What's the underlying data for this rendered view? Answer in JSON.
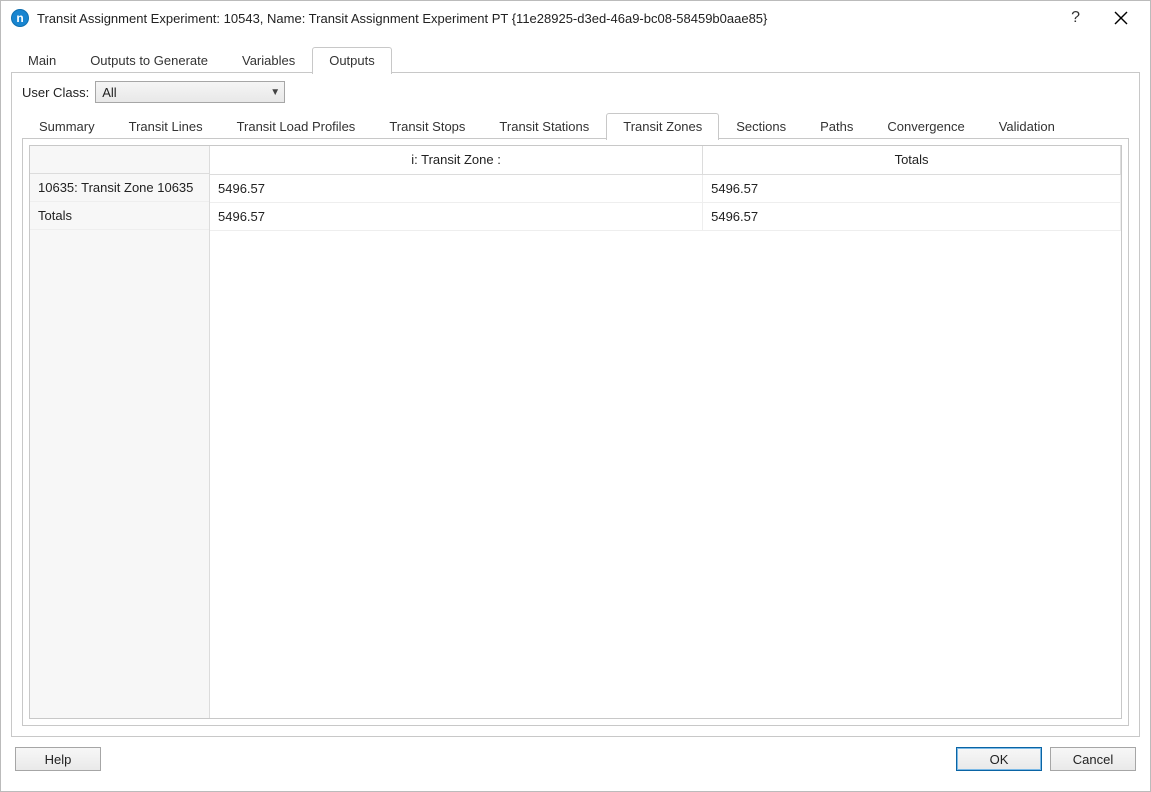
{
  "window": {
    "title": "Transit Assignment Experiment: 10543, Name: Transit Assignment Experiment PT  {11e28925-d3ed-46a9-bc08-58459b0aae85}",
    "icon_letter": "n",
    "help_glyph": "?",
    "close_glyph": "✕"
  },
  "top_tabs": {
    "main": "Main",
    "outputs_to_generate": "Outputs to Generate",
    "variables": "Variables",
    "outputs": "Outputs",
    "active": "outputs"
  },
  "user_class": {
    "label": "User Class:",
    "value": "All"
  },
  "sub_tabs": {
    "summary": "Summary",
    "transit_lines": "Transit Lines",
    "transit_load_profiles": "Transit Load Profiles",
    "transit_stops": "Transit Stops",
    "transit_stations": "Transit Stations",
    "transit_zones": "Transit Zones",
    "sections": "Sections",
    "paths": "Paths",
    "convergence": "Convergence",
    "validation": "Validation",
    "active": "transit_zones"
  },
  "table": {
    "columns": [
      "i: Transit Zone :",
      "Totals"
    ],
    "row_headers": [
      "10635: Transit Zone 10635",
      "Totals"
    ],
    "rows": [
      [
        "5496.57",
        "5496.57"
      ],
      [
        "5496.57",
        "5496.57"
      ]
    ]
  },
  "footer": {
    "help": "Help",
    "ok": "OK",
    "cancel": "Cancel"
  }
}
